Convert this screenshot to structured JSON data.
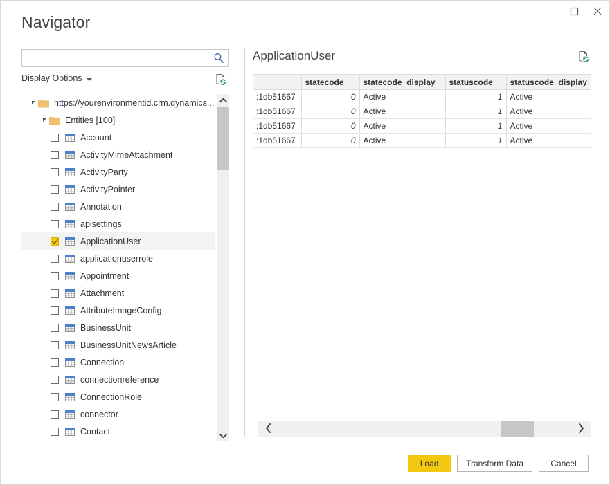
{
  "window": {
    "title": "Navigator",
    "controls": [
      {
        "name": "maximize",
        "glyph": "maximize-icon"
      },
      {
        "name": "close",
        "glyph": "close-icon"
      }
    ]
  },
  "left_panel": {
    "search": {
      "value": "",
      "placeholder": "",
      "icon": "search-icon"
    },
    "display_options": {
      "label": "Display Options",
      "caret": "chevron-down-icon"
    },
    "refresh_icon": "refresh-document-icon",
    "tree": [
      {
        "type": "folder",
        "depth": 0,
        "label": "https://yourenvironmentid.crm.dynamics...",
        "expanded": true,
        "selected": false
      },
      {
        "type": "folder",
        "depth": 1,
        "label": "Entities [100]",
        "expanded": true,
        "selected": false
      },
      {
        "type": "table",
        "depth": 2,
        "label": "Account",
        "checked": false,
        "selected": false
      },
      {
        "type": "table",
        "depth": 2,
        "label": "ActivityMimeAttachment",
        "checked": false,
        "selected": false
      },
      {
        "type": "table",
        "depth": 2,
        "label": "ActivityParty",
        "checked": false,
        "selected": false
      },
      {
        "type": "table",
        "depth": 2,
        "label": "ActivityPointer",
        "checked": false,
        "selected": false
      },
      {
        "type": "table",
        "depth": 2,
        "label": "Annotation",
        "checked": false,
        "selected": false
      },
      {
        "type": "table",
        "depth": 2,
        "label": "apisettings",
        "checked": false,
        "selected": false
      },
      {
        "type": "table",
        "depth": 2,
        "label": "ApplicationUser",
        "checked": true,
        "selected": true
      },
      {
        "type": "table",
        "depth": 2,
        "label": "applicationuserrole",
        "checked": false,
        "selected": false
      },
      {
        "type": "table",
        "depth": 2,
        "label": "Appointment",
        "checked": false,
        "selected": false
      },
      {
        "type": "table",
        "depth": 2,
        "label": "Attachment",
        "checked": false,
        "selected": false
      },
      {
        "type": "table",
        "depth": 2,
        "label": "AttributeImageConfig",
        "checked": false,
        "selected": false
      },
      {
        "type": "table",
        "depth": 2,
        "label": "BusinessUnit",
        "checked": false,
        "selected": false
      },
      {
        "type": "table",
        "depth": 2,
        "label": "BusinessUnitNewsArticle",
        "checked": false,
        "selected": false
      },
      {
        "type": "table",
        "depth": 2,
        "label": "Connection",
        "checked": false,
        "selected": false
      },
      {
        "type": "table",
        "depth": 2,
        "label": "connectionreference",
        "checked": false,
        "selected": false
      },
      {
        "type": "table",
        "depth": 2,
        "label": "ConnectionRole",
        "checked": false,
        "selected": false
      },
      {
        "type": "table",
        "depth": 2,
        "label": "connector",
        "checked": false,
        "selected": false
      },
      {
        "type": "table",
        "depth": 2,
        "label": "Contact",
        "checked": false,
        "selected": false
      }
    ],
    "scrollbar": {
      "up_icon": "chevron-up-icon",
      "down_icon": "chevron-down-icon"
    }
  },
  "right_panel": {
    "title": "ApplicationUser",
    "refresh_icon": "refresh-document-icon",
    "table": {
      "columns": [
        "",
        "statecode",
        "statecode_display",
        "statuscode",
        "statuscode_display"
      ],
      "rows": [
        [
          ":1db51667",
          "0",
          "Active",
          "1",
          "Active"
        ],
        [
          ":1db51667",
          "0",
          "Active",
          "1",
          "Active"
        ],
        [
          ":1db51667",
          "0",
          "Active",
          "1",
          "Active"
        ],
        [
          ":1db51667",
          "0",
          "Active",
          "1",
          "Active"
        ]
      ]
    },
    "hscrollbar": {
      "left_icon": "chevron-left-icon",
      "right_icon": "chevron-right-icon"
    }
  },
  "footer": {
    "load_label": "Load",
    "transform_label": "Transform Data",
    "cancel_label": "Cancel"
  },
  "colors": {
    "accent": "#f2c811",
    "table_icon_header": "#4a83c3",
    "folder": "#f0c070",
    "search_icon": "#2a5fa0"
  }
}
